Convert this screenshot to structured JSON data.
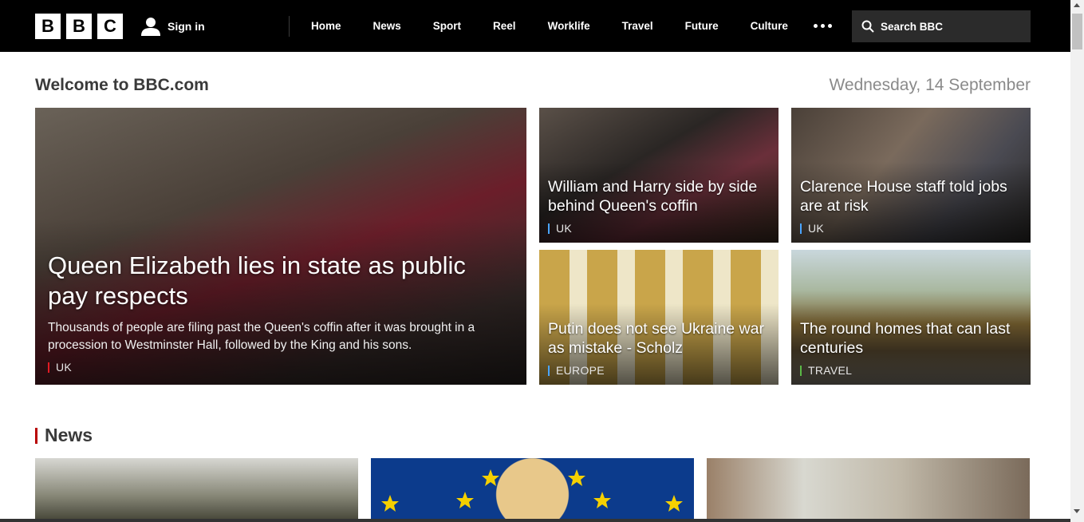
{
  "header": {
    "logo": [
      "B",
      "B",
      "C"
    ],
    "signin_label": "Sign in",
    "nav": [
      "Home",
      "News",
      "Sport",
      "Reel",
      "Worklife",
      "Travel",
      "Future",
      "Culture"
    ],
    "search_label": "Search BBC"
  },
  "welcome": {
    "title": "Welcome to BBC.com",
    "date": "Wednesday, 14 September"
  },
  "hero": {
    "title": "Queen Elizabeth lies in state as public pay respects",
    "summary": "Thousands of people are filing past the Queen's coffin after it was brought in a procession to Westminster Hall, followed by the King and his sons.",
    "tag": "UK",
    "tag_color": "#e31b23"
  },
  "promos": [
    {
      "title": "William and Harry side by side behind Queen's coffin",
      "tag": "UK",
      "tag_color": "#4aa5ff"
    },
    {
      "title": "Clarence House staff told jobs are at risk",
      "tag": "UK",
      "tag_color": "#4aa5ff"
    },
    {
      "title": "Putin does not see Ukraine war as mistake - Scholz",
      "tag": "EUROPE",
      "tag_color": "#4aa5ff"
    },
    {
      "title": "The round homes that can last centuries",
      "tag": "TRAVEL",
      "tag_color": "#5ab946"
    }
  ],
  "news_section": {
    "title": "News",
    "accent": "#b80000"
  }
}
